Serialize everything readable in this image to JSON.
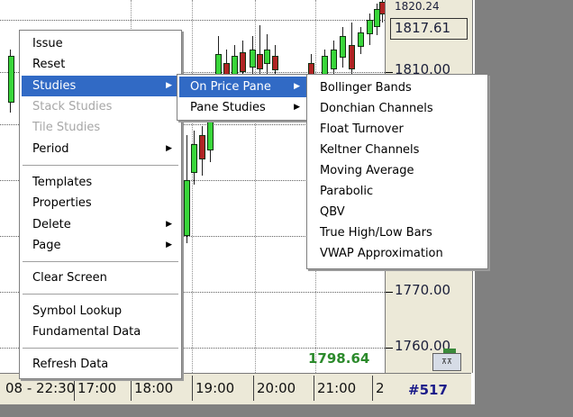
{
  "chart": {
    "price_top": "1820.24",
    "price_current_box": "1817.61",
    "price_levels": [
      "1810.00",
      "1770.00",
      "1760.00"
    ],
    "last_price": "1798.64",
    "time_labels": [
      "08 - 22:30",
      "17:00",
      "18:00",
      "19:00",
      "20:00",
      "21:00",
      "2"
    ],
    "bar_count": "#517",
    "colors": {
      "up": "#39d63a",
      "down": "#b02424",
      "last_price": "#2b8a2b",
      "bar_count": "#1c1c8a"
    }
  },
  "context_menu": {
    "items": [
      {
        "label": "Issue",
        "enabled": true,
        "submenu": false
      },
      {
        "label": "Reset",
        "enabled": true,
        "submenu": false
      },
      {
        "label": "Studies",
        "enabled": true,
        "submenu": true,
        "selected": true
      },
      {
        "label": "Stack Studies",
        "enabled": false,
        "submenu": false
      },
      {
        "label": "Tile Studies",
        "enabled": false,
        "submenu": false
      },
      {
        "label": "Period",
        "enabled": true,
        "submenu": true
      },
      {
        "label": "Templates",
        "enabled": true,
        "submenu": false
      },
      {
        "label": "Properties",
        "enabled": true,
        "submenu": false
      },
      {
        "label": "Delete",
        "enabled": true,
        "submenu": true
      },
      {
        "label": "Page",
        "enabled": true,
        "submenu": true
      },
      {
        "label": "Clear Screen",
        "enabled": true,
        "submenu": false
      },
      {
        "label": "Symbol Lookup",
        "enabled": true,
        "submenu": false
      },
      {
        "label": "Fundamental Data",
        "enabled": true,
        "submenu": false
      },
      {
        "label": "Refresh Data",
        "enabled": true,
        "submenu": false
      }
    ]
  },
  "studies_submenu": {
    "items": [
      {
        "label": "On Price Pane",
        "submenu": true,
        "selected": true
      },
      {
        "label": "Pane Studies",
        "submenu": true
      }
    ]
  },
  "price_pane_submenu": {
    "items": [
      "Bollinger Bands",
      "Donchian Channels",
      "Float Turnover",
      "Keltner Channels",
      "Moving Average",
      "Parabolic",
      "QBV",
      "True High/Low Bars",
      "VWAP Approximation"
    ]
  },
  "icons": {
    "submenu_arrow": "triangle-right-icon",
    "corner": "chart-toggle-icon"
  }
}
